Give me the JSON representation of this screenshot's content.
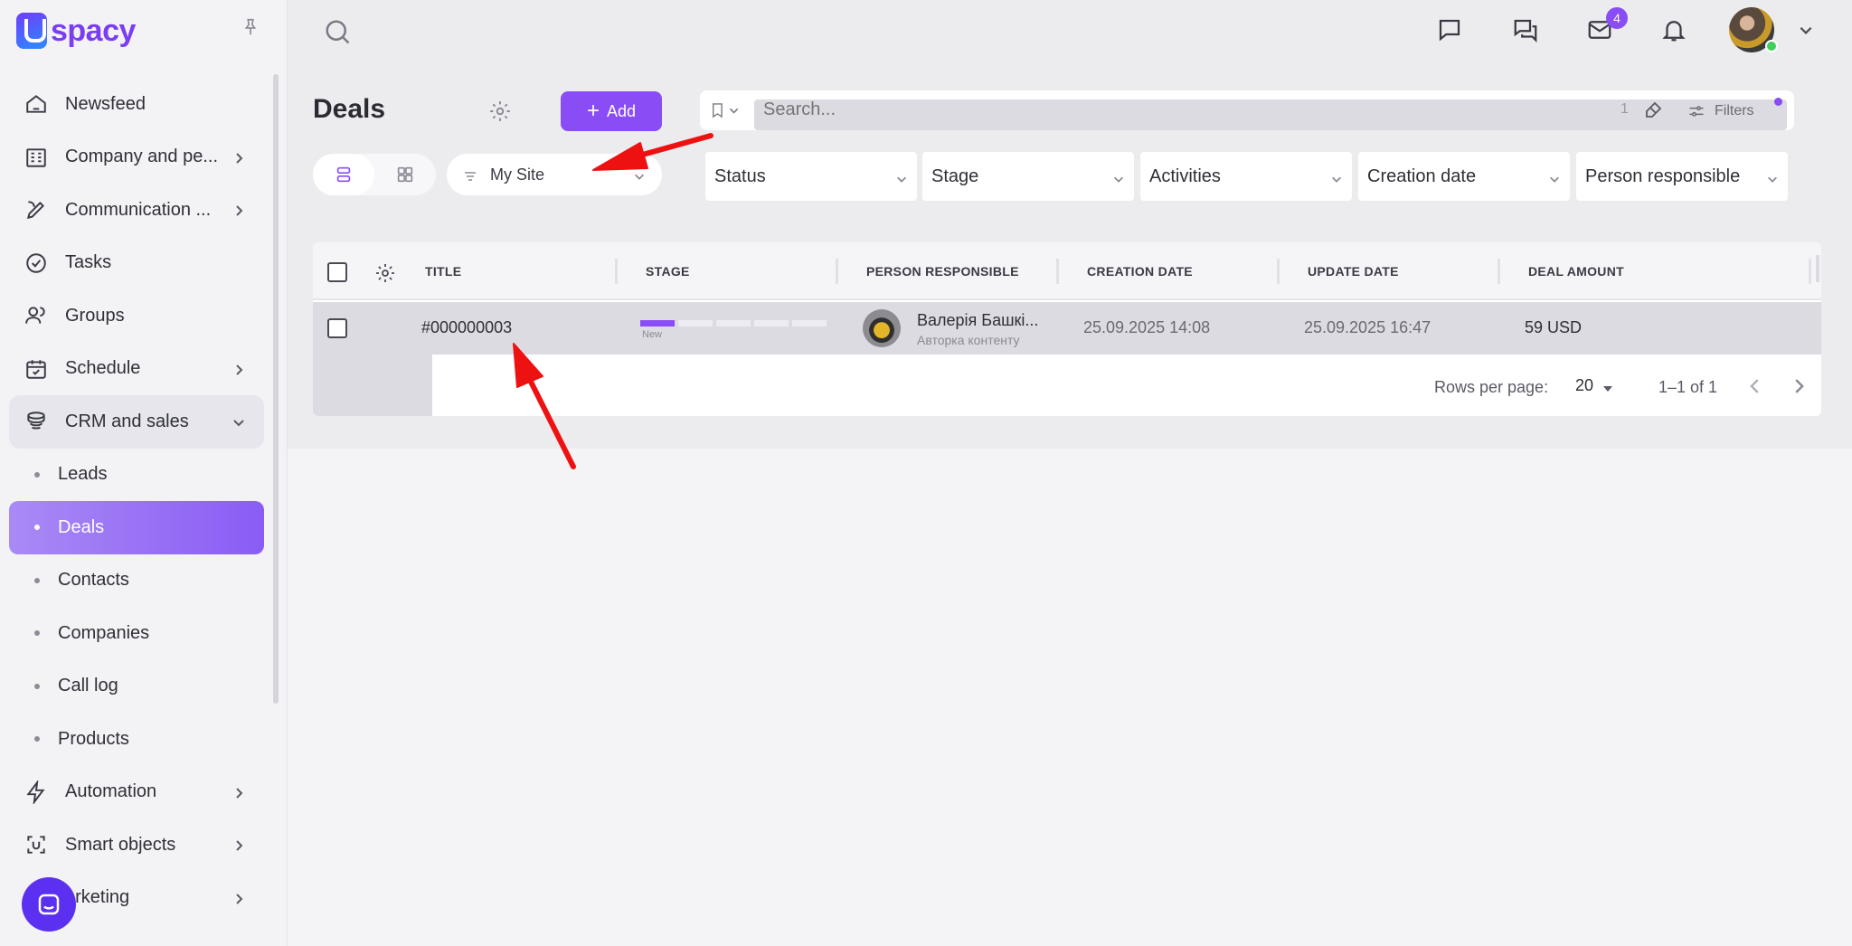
{
  "brand": {
    "name": "spacy"
  },
  "sidebar": {
    "items": [
      {
        "label": "Newsfeed",
        "icon": "home-icon",
        "has_chevron": false
      },
      {
        "label": "Company and pe...",
        "icon": "company-icon",
        "has_chevron": true
      },
      {
        "label": "Communication ...",
        "icon": "communication-icon",
        "has_chevron": true
      },
      {
        "label": "Tasks",
        "icon": "tasks-icon",
        "has_chevron": false
      },
      {
        "label": "Groups",
        "icon": "groups-icon",
        "has_chevron": false
      },
      {
        "label": "Schedule",
        "icon": "calendar-icon",
        "has_chevron": true
      },
      {
        "label": "CRM and sales",
        "icon": "crm-icon",
        "has_chevron": true,
        "expanded": true
      }
    ],
    "crm_subitems": [
      "Leads",
      "Deals",
      "Contacts",
      "Companies",
      "Call log",
      "Products"
    ],
    "active_subitem": "Deals",
    "items_after": [
      {
        "label": "Automation",
        "icon": "lightning-icon"
      },
      {
        "label": "Smart objects",
        "icon": "smart-objects-icon"
      },
      {
        "label": "arketing",
        "icon": "marketing-icon"
      }
    ]
  },
  "topbar": {
    "notification_count": "4"
  },
  "page": {
    "title": "Deals",
    "add_label": "Add",
    "search_placeholder": "Search...",
    "search_count": "1",
    "filters_label": "Filters",
    "site_filter": "My Site"
  },
  "filters": [
    "Status",
    "Stage",
    "Activities",
    "Creation date",
    "Person responsible"
  ],
  "table": {
    "columns": [
      "TITLE",
      "STAGE",
      "PERSON RESPONSIBLE",
      "CREATION DATE",
      "UPDATE DATE",
      "DEAL AMOUNT"
    ],
    "rows": [
      {
        "title": "#000000003",
        "stage": "New",
        "stage_progress_segments": 5,
        "stage_filled_segments": 1,
        "person_name": "Валерія Башкі...",
        "person_role": "Авторка контенту",
        "creation_date": "25.09.2025 14:08",
        "update_date": "25.09.2025 16:47",
        "amount": "59 USD"
      }
    ],
    "pagination": {
      "rows_per_page_label": "Rows per page:",
      "rows_per_page": "20",
      "range": "1–1 of 1"
    }
  },
  "colors": {
    "accent": "#8a4cf5",
    "active_nav": "#9b72f5",
    "annotation_arrow": "#ee1111"
  }
}
